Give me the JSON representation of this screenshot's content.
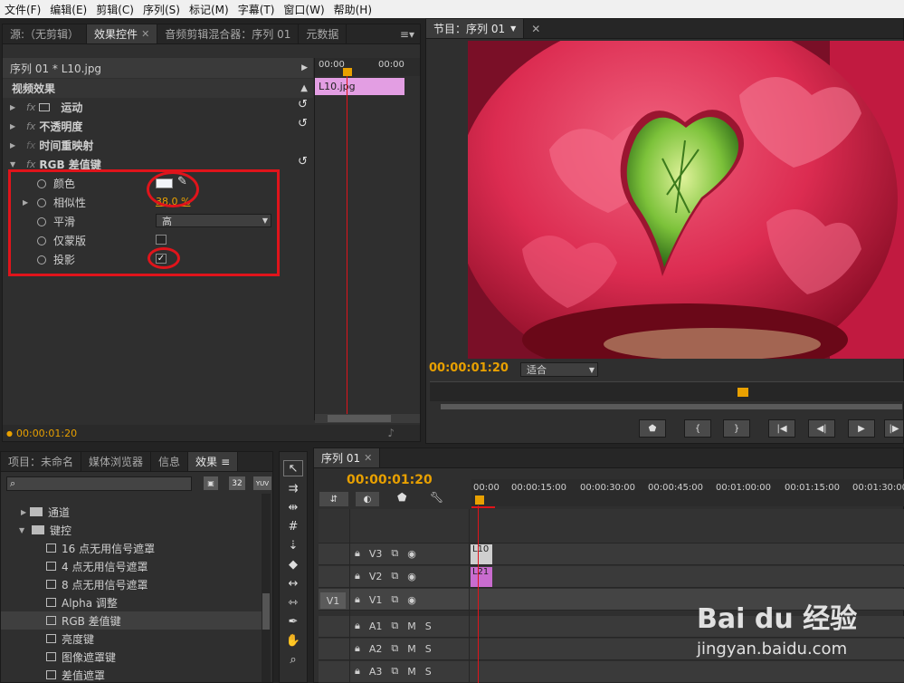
{
  "menubar": {
    "items": [
      "文件(F)",
      "编辑(E)",
      "剪辑(C)",
      "序列(S)",
      "标记(M)",
      "字幕(T)",
      "窗口(W)",
      "帮助(H)"
    ]
  },
  "effect_panel": {
    "tabs": [
      {
        "label": "源:（无剪辑）"
      },
      {
        "label": "效果控件"
      },
      {
        "label": "音频剪辑混合器：序列 01"
      },
      {
        "label": "元数据"
      }
    ],
    "clip_header": "序列 01 * L10.jpg",
    "time_start": "00:00",
    "time_end": "00:00",
    "clip_name": "L10.jpg",
    "section": "视频效果",
    "effects": [
      {
        "label": "运动"
      },
      {
        "label": "不透明度"
      },
      {
        "label": "时间重映射"
      },
      {
        "label": "RGB 差值键"
      }
    ],
    "params": {
      "color_label": "颜色",
      "similarity_label": "相似性",
      "similarity_value": "38.0 %",
      "smooth_label": "平滑",
      "smooth_value": "高",
      "mask_only_label": "仅蒙版",
      "shadow_label": "投影"
    },
    "footer_time": "00:00:01:20"
  },
  "program_monitor": {
    "tab_label": "节目：序列 01",
    "timecode": "00:00:01:20",
    "fit_label": "适合"
  },
  "project_panel": {
    "tabs": [
      {
        "label": "项目：未命名"
      },
      {
        "label": "媒体浏览器"
      },
      {
        "label": "信息"
      },
      {
        "label": "效果"
      }
    ],
    "tree": [
      {
        "label": "通道",
        "kind": "folder",
        "expanded": false
      },
      {
        "label": "键控",
        "kind": "folder",
        "expanded": true
      },
      {
        "label": "16 点无用信号遮罩",
        "kind": "effect"
      },
      {
        "label": "4 点无用信号遮罩",
        "kind": "effect"
      },
      {
        "label": "8 点无用信号遮罩",
        "kind": "effect"
      },
      {
        "label": "Alpha 调整",
        "kind": "effect"
      },
      {
        "label": "RGB 差值键",
        "kind": "effect"
      },
      {
        "label": "亮度键",
        "kind": "effect"
      },
      {
        "label": "图像遮罩键",
        "kind": "effect"
      },
      {
        "label": "差值遮罩",
        "kind": "effect"
      }
    ],
    "badges": [
      "32",
      "YUV"
    ]
  },
  "timeline": {
    "tab_label": "序列 01",
    "timecode": "00:00:01:20",
    "ruler": [
      "00:00",
      "00:00:15:00",
      "00:00:30:00",
      "00:00:45:00",
      "00:01:00:00",
      "00:01:15:00",
      "00:01:30:00"
    ],
    "video_tracks": [
      {
        "name": "V3",
        "clip": "L10"
      },
      {
        "name": "V2",
        "clip": "L21"
      },
      {
        "name": "V1",
        "source": "V1"
      }
    ],
    "audio_tracks": [
      {
        "name": "A1",
        "m": "M",
        "s": "S"
      },
      {
        "name": "A2",
        "m": "M",
        "s": "S"
      },
      {
        "name": "A3",
        "m": "M",
        "s": "S"
      }
    ]
  },
  "watermark": {
    "brand": "Bai du 经验",
    "url": "jingyan.baidu.com"
  },
  "colors": {
    "accent": "#e8a000",
    "playhead": "#e0141b",
    "clip_pink": "#e39ee3",
    "highlight_red": "#e0141b"
  }
}
